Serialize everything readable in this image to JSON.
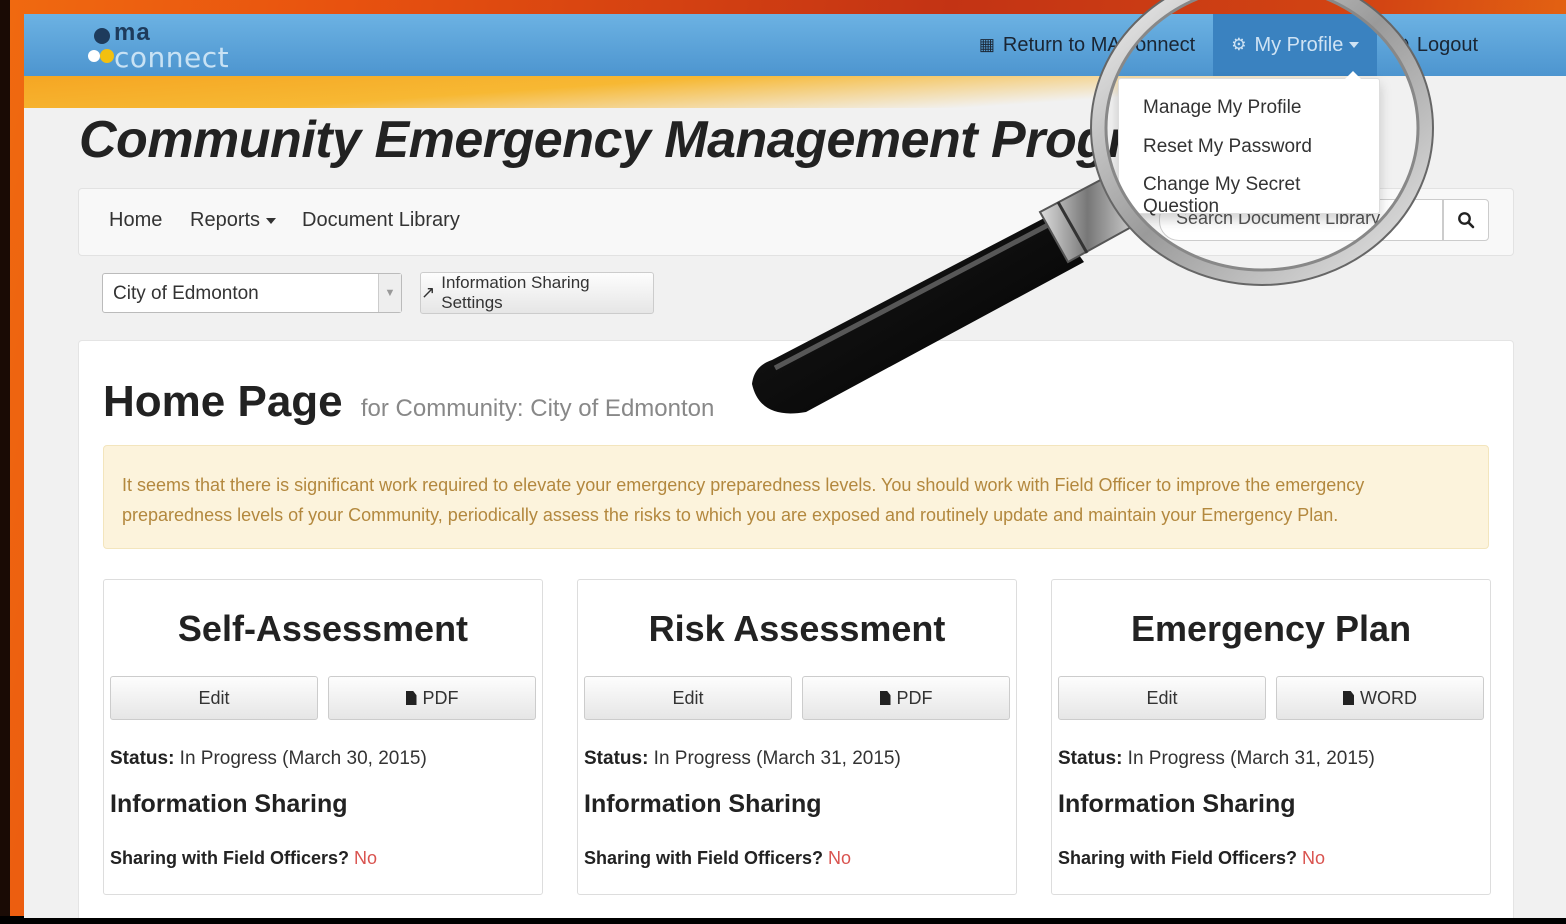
{
  "brand": {
    "logo_top": "ma",
    "logo_bottom": "connect"
  },
  "topnav": {
    "return_label": "Return to MAConnect",
    "profile_label": "My Profile",
    "logout_label": "Logout"
  },
  "profile_menu": {
    "items": [
      "Manage My Profile",
      "Reset My Password",
      "Change My Secret Question"
    ]
  },
  "title": "Community Emergency Management Program",
  "mainnav": {
    "home": "Home",
    "reports": "Reports",
    "library": "Document Library",
    "search_placeholder": "Search Document Library"
  },
  "community_select": "City of Edmonton",
  "info_sharing_settings": "Information Sharing Settings",
  "home": {
    "title": "Home Page",
    "subtitle": "for Community: City of Edmonton",
    "alert": "It seems that there is significant work required to elevate your emergency preparedness levels. You should work with Field Officer to improve the emergency preparedness levels of your Community, periodically assess the risks to which you are exposed and routinely update and maintain your Emergency Plan."
  },
  "cards": [
    {
      "title": "Self-Assessment",
      "edit": "Edit",
      "doc": "PDF",
      "status_label": "Status:",
      "status": " In Progress (March 30, 2015)",
      "info_heading": "Information Sharing",
      "share_label": "Sharing with Field Officers?",
      "share_value": "No"
    },
    {
      "title": "Risk Assessment",
      "edit": "Edit",
      "doc": "PDF",
      "status_label": "Status:",
      "status": " In Progress (March 31, 2015)",
      "info_heading": "Information Sharing",
      "share_label": "Sharing with Field Officers?",
      "share_value": "No"
    },
    {
      "title": "Emergency Plan",
      "edit": "Edit",
      "doc": "WORD",
      "status_label": "Status:",
      "status": " In Progress (March 31, 2015)",
      "info_heading": "Information Sharing",
      "share_label": "Sharing with Field Officers?",
      "share_value": "No"
    }
  ],
  "colors": {
    "topbar": "#4d95cf",
    "active_tab": "#3a82c0",
    "alert_bg": "#fcf3dc",
    "alert_text": "#b3883e",
    "no_value": "#d9534f"
  }
}
